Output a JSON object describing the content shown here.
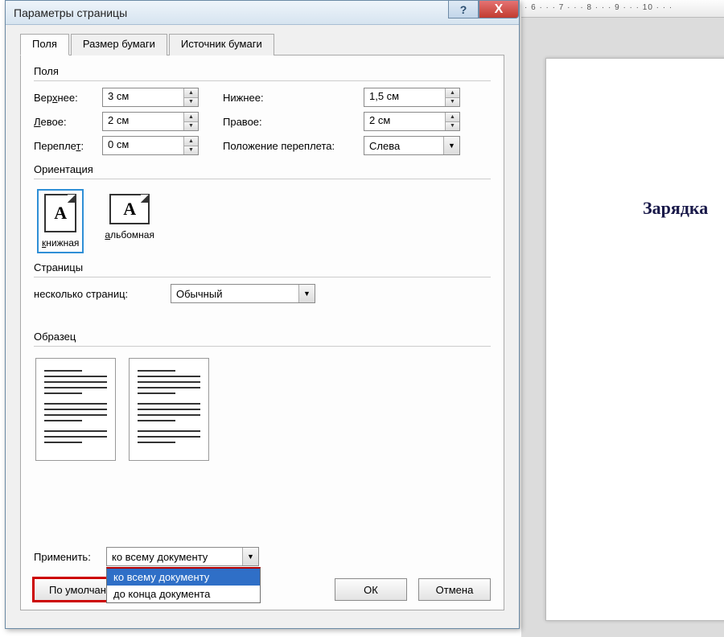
{
  "ruler_text": "· 6 · · · 7 · · · 8 · · · 9 · · · 10 · · ·",
  "doc_heading": "Зарядка",
  "dialog": {
    "title": "Параметры страницы",
    "tabs": {
      "margins": "Поля",
      "paper": "Размер бумаги",
      "source": "Источник бумаги"
    },
    "help": "?",
    "close": "X"
  },
  "margins": {
    "group": "Поля",
    "top_lbl": "Верхнее:",
    "top_u": "х",
    "top_val": "3 см",
    "bottom_lbl": "Нижнее:",
    "bottom_u": "ж",
    "bottom_val": "1,5 см",
    "left_lbl": "Левое:",
    "left_u": "Л",
    "left_val": "2 см",
    "right_lbl": "Правое:",
    "right_u": "П",
    "right_val": "2 см",
    "gutter_lbl": "Переплет:",
    "gutter_u": "т",
    "gutter_val": "0 см",
    "gutterpos_lbl": "Положение переплета:",
    "gutterpos_val": "Слева"
  },
  "orientation": {
    "group": "Ориентация",
    "portrait": "книжная",
    "portrait_u": "к",
    "landscape": "альбомная",
    "landscape_u": "а",
    "glyph": "A"
  },
  "pages": {
    "group": "Страницы",
    "multi_lbl": "несколько страниц:",
    "multi_u": "н",
    "multi_val": "Обычный"
  },
  "sample": {
    "group": "Образец"
  },
  "apply": {
    "lbl": "Применить:",
    "u": "т",
    "val": "ко всему документу",
    "options": [
      "ко всему документу",
      "до конца документа"
    ],
    "sel_index": 0
  },
  "buttons": {
    "default": "По умолчанию",
    "default_u": "П",
    "ok": "ОК",
    "cancel": "Отмена"
  }
}
